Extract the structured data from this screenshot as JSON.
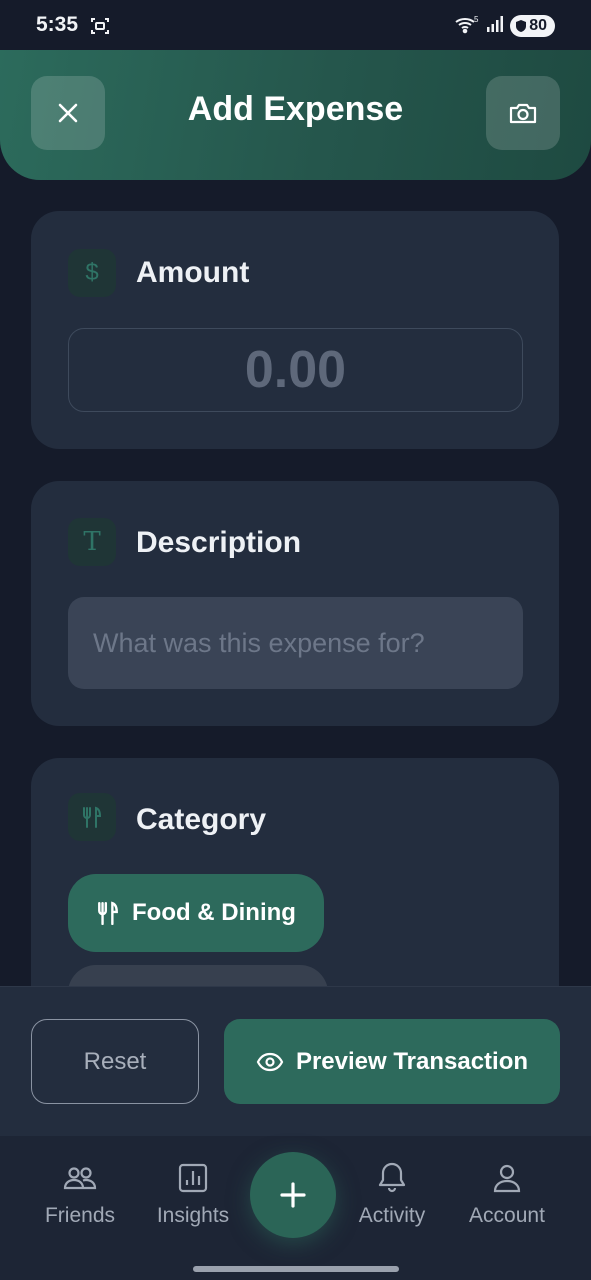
{
  "status_bar": {
    "time": "5:35",
    "battery": "80",
    "wifi_badge": "5"
  },
  "header": {
    "title": "Add Expense",
    "close_icon": "close-icon",
    "camera_icon": "camera-icon"
  },
  "amount": {
    "title": "Amount",
    "icon": "dollar-icon",
    "placeholder": "0.00"
  },
  "description": {
    "title": "Description",
    "icon": "text-icon",
    "placeholder": "What was this expense for?"
  },
  "category": {
    "title": "Category",
    "icon": "utensils-icon",
    "selected_chip": "Food & Dining"
  },
  "actions": {
    "reset_label": "Reset",
    "preview_label": "Preview Transaction"
  },
  "nav": {
    "items": [
      {
        "label": "Friends",
        "icon": "friends-icon"
      },
      {
        "label": "Insights",
        "icon": "chart-icon"
      },
      {
        "label": "Activity",
        "icon": "bell-icon"
      },
      {
        "label": "Account",
        "icon": "user-icon"
      }
    ],
    "fab_icon": "plus-icon"
  },
  "colors": {
    "accent": "#2d6a5c",
    "background": "#151b2a",
    "card": "#232d3e"
  }
}
